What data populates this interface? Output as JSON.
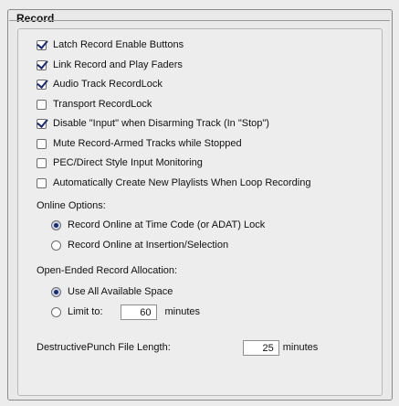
{
  "section": {
    "title": "Record"
  },
  "checkboxes": [
    {
      "label": "Latch Record Enable Buttons",
      "checked": true
    },
    {
      "label": "Link Record and Play Faders",
      "checked": true
    },
    {
      "label": "Audio Track RecordLock",
      "checked": true
    },
    {
      "label": "Transport RecordLock",
      "checked": false
    },
    {
      "label": "Disable \"Input\" when Disarming Track (In \"Stop\")",
      "checked": true
    },
    {
      "label": "Mute Record-Armed Tracks while Stopped",
      "checked": false
    },
    {
      "label": "PEC/Direct Style Input Monitoring",
      "checked": false
    },
    {
      "label": "Automatically Create New Playlists When Loop Recording",
      "checked": false
    }
  ],
  "online_options": {
    "heading": "Online Options:",
    "options": [
      {
        "label": "Record Online at Time Code (or ADAT) Lock",
        "selected": true
      },
      {
        "label": "Record Online at Insertion/Selection",
        "selected": false
      }
    ]
  },
  "open_ended": {
    "heading": "Open-Ended Record Allocation:",
    "use_all_label": "Use All Available Space",
    "use_all_selected": true,
    "limit_label": "Limit to:",
    "limit_selected": false,
    "limit_value": "60",
    "limit_unit": "minutes"
  },
  "destructive_punch": {
    "label": "DestructivePunch File Length:",
    "value": "25",
    "unit": "minutes"
  }
}
